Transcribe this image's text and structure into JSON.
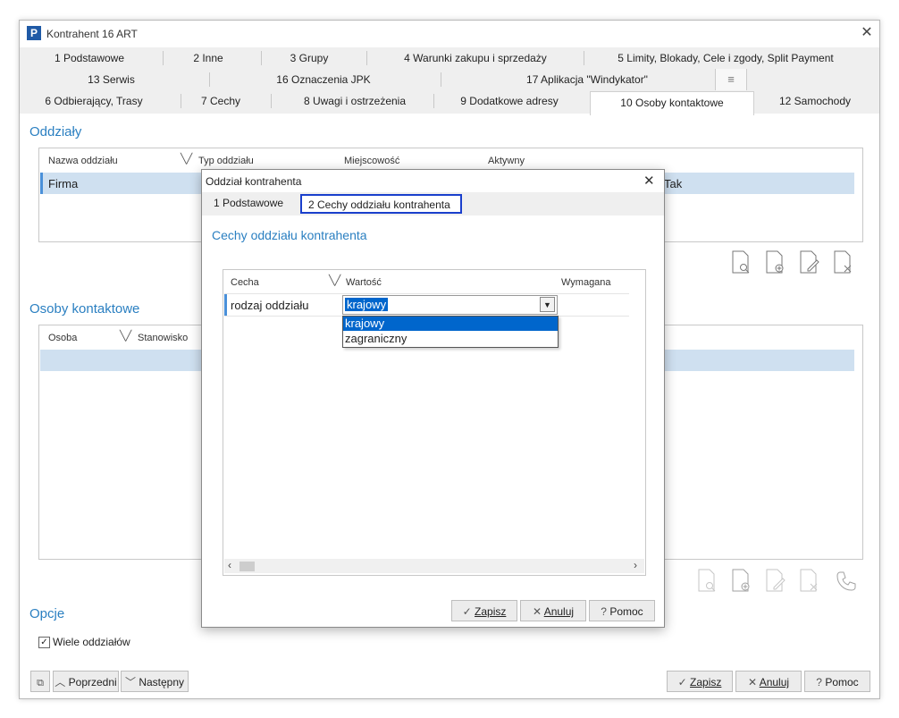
{
  "window": {
    "title": "Kontrahent 16   ART"
  },
  "tabs_row1": [
    "1 Podstawowe",
    "2 Inne",
    "3 Grupy",
    "4 Warunki zakupu i sprzedaży",
    "5 Limity, Blokady, Cele i zgody, Split Payment"
  ],
  "tabs_row2": [
    "13 Serwis",
    "16 Oznaczenia JPK",
    "17 Aplikacja \"Windykator\""
  ],
  "tabs_row3": [
    "6 Odbierający, Trasy",
    "7 Cechy",
    "8 Uwagi i ostrzeżenia",
    "9 Dodatkowe adresy",
    "10 Osoby kontaktowe",
    "12 Samochody"
  ],
  "oddzialy": {
    "heading": "Oddziały",
    "columns": [
      "Nazwa oddziału",
      "Typ oddziału",
      "Miejscowość",
      "Aktywny"
    ],
    "row": {
      "name": "Firma",
      "active": "Tak"
    }
  },
  "osoby": {
    "heading": "Osoby kontaktowe",
    "columns": [
      "Osoba",
      "Stanowisko"
    ]
  },
  "opcje": {
    "heading": "Opcje",
    "checkbox_label": "Wiele oddziałów",
    "checkbox_checked": true
  },
  "footer": {
    "prev": "Poprzedni",
    "next": "Następny",
    "save": "Zapisz",
    "cancel": "Anuluj",
    "help": "Pomoc"
  },
  "dialog": {
    "title": "Oddział kontrahenta",
    "tabs": [
      "1 Podstawowe",
      "2 Cechy oddziału kontrahenta"
    ],
    "heading": "Cechy oddziału kontrahenta",
    "columns": [
      "Cecha",
      "Wartość",
      "Wymagana"
    ],
    "row": {
      "cecha": "rodzaj oddziału",
      "wartosc": "krajowy"
    },
    "dropdown_options": [
      "krajowy",
      "zagraniczny"
    ],
    "save": "Zapisz",
    "cancel": "Anuluj",
    "help": "Pomoc"
  },
  "icons": [
    "search-doc-icon",
    "add-doc-icon",
    "edit-doc-icon",
    "delete-doc-icon",
    "phone-icon"
  ],
  "colors": {
    "accent": "#2a7fc1",
    "selected_row": "#cfe0f0",
    "highlight": "#0066cc",
    "focus_border": "#1a3fcc"
  }
}
